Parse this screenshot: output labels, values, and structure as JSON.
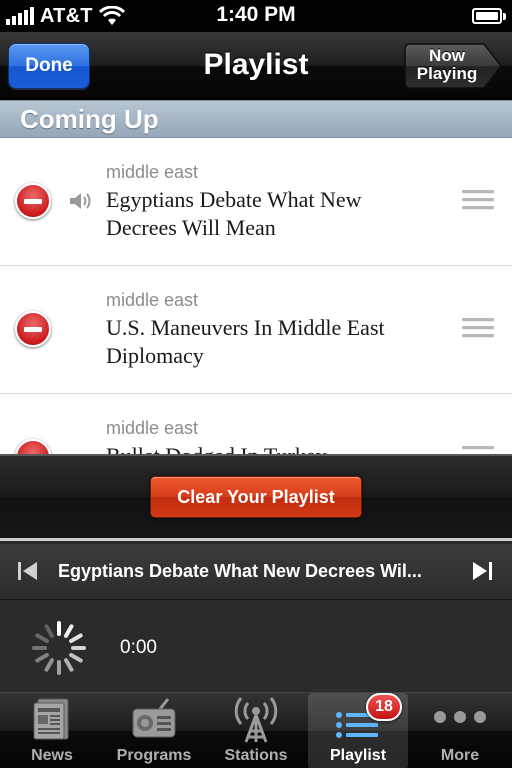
{
  "status_bar": {
    "carrier": "AT&T",
    "time": "1:40 PM",
    "icons": [
      "signal-icon",
      "wifi-icon",
      "battery-icon"
    ]
  },
  "nav": {
    "title": "Playlist",
    "done_label": "Done",
    "now_playing_label_line1": "Now",
    "now_playing_label_line2": "Playing"
  },
  "section_header": "Coming Up",
  "playlist": [
    {
      "category": "middle east",
      "title": "Egyptians Debate What New Decrees Will Mean",
      "playing": true
    },
    {
      "category": "middle east",
      "title": "U.S. Maneuvers In Middle East Diplomacy",
      "playing": false
    },
    {
      "category": "middle east",
      "title": "Bullet Dodged In Turkey",
      "playing": false
    }
  ],
  "clear_label": "Clear Your Playlist",
  "player": {
    "track": "Egyptians Debate What New Decrees Wil...",
    "elapsed": "0:00"
  },
  "tabs": [
    {
      "label": "News",
      "icon": "newspaper-icon"
    },
    {
      "label": "Programs",
      "icon": "radio-icon"
    },
    {
      "label": "Stations",
      "icon": "antenna-icon"
    },
    {
      "label": "Playlist",
      "icon": "playlist-icon",
      "badge": "18",
      "active": true
    },
    {
      "label": "More",
      "icon": "more-icon"
    }
  ],
  "colors": {
    "done_button": "#2f6fe0",
    "clear_button": "#d63c1a",
    "delete_button": "#c81a1a",
    "section_header": "#a9b8c6"
  }
}
